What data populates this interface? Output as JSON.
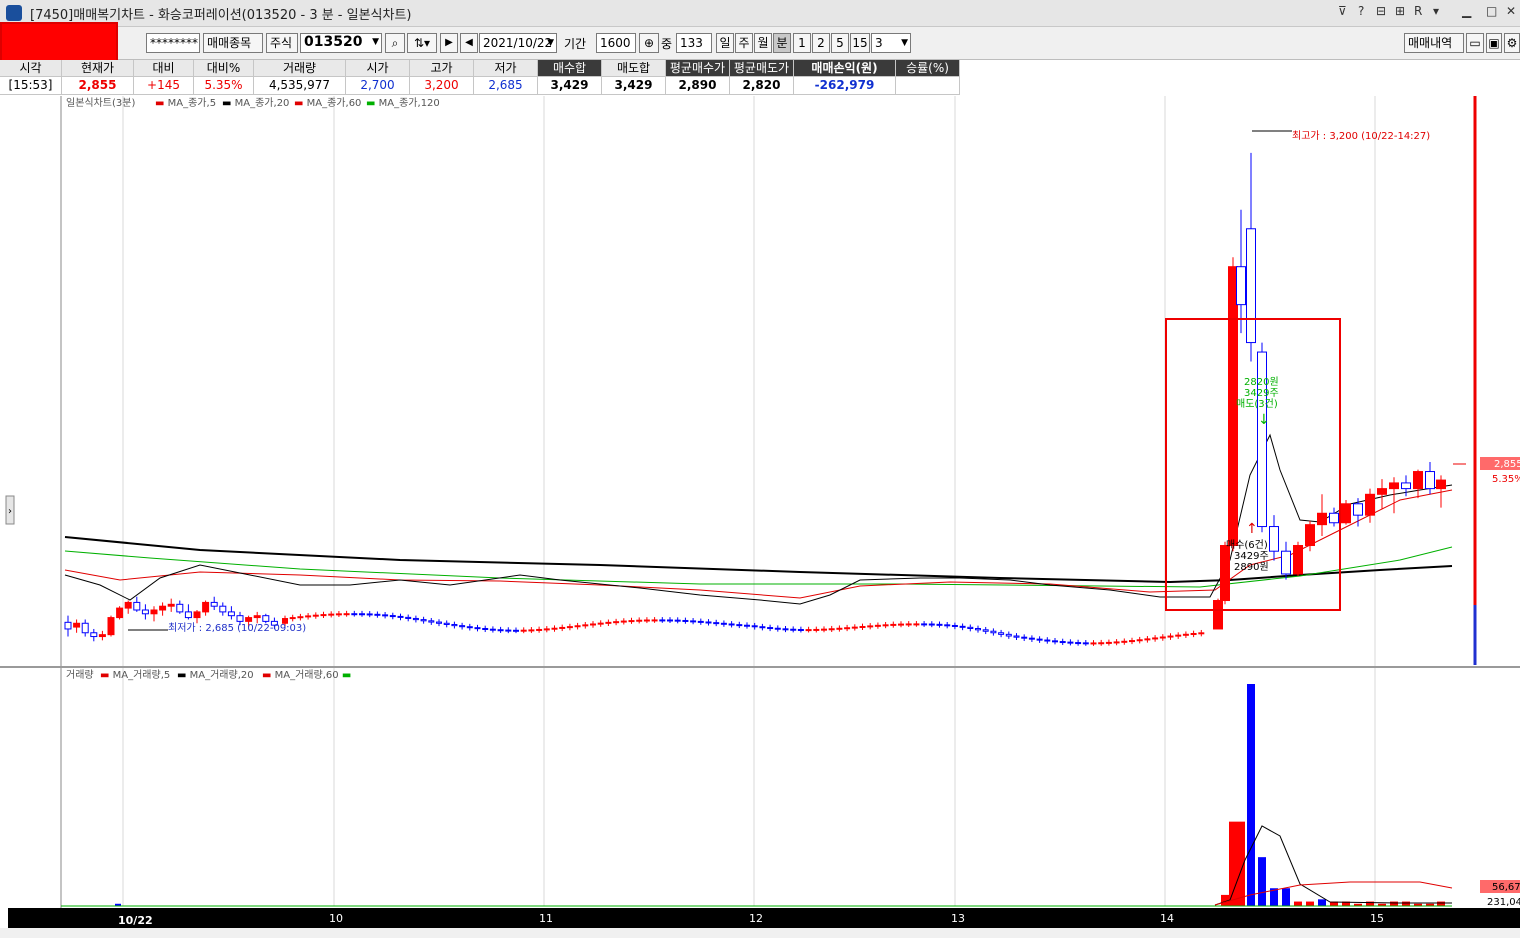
{
  "window": {
    "title": "[7450]매매복기차트 - 화승코퍼레이션(013520 - 3 분 - 일본식차트)",
    "controls": [
      "?",
      "R"
    ]
  },
  "toolbar": {
    "password": "********",
    "trade_item_btn": "매매종목",
    "market_type": "주식",
    "code": "013520",
    "date": "2021/10/22",
    "period_label": "기간",
    "period_value": "1600",
    "mid_label": "중",
    "mid_value": "133",
    "tf_day": "일",
    "tf_week": "주",
    "tf_month": "월",
    "tf_min": "분",
    "n1": "1",
    "n2": "2",
    "n5": "5",
    "n15": "15",
    "interval": "3",
    "history_btn": "매매내역"
  },
  "info": {
    "headers": [
      "시각",
      "현재가",
      "대비",
      "대비%",
      "거래량",
      "시가",
      "고가",
      "저가",
      "매수합",
      "매도합",
      "평균매수가",
      "평균매도가",
      "매매손익(원)",
      "승률(%)"
    ],
    "values": [
      "[15:53]",
      "2,855",
      "+145",
      "5.35%",
      "4,535,977",
      "2,700",
      "3,200",
      "2,685",
      "3,429",
      "3,429",
      "2,890",
      "2,820",
      "-262,979",
      ""
    ]
  },
  "chart_data": {
    "type": "candlestick",
    "price_legend": [
      "일본식차트(3분)",
      "MA_종가,5",
      "MA_종가,20",
      "MA_종가,60",
      "MA_종가,120"
    ],
    "volume_legend": [
      "거래량",
      "MA_거래량,5",
      "MA_거래량,20",
      "MA_거래량,60"
    ],
    "x_tick_labels": [
      "10/22",
      "10",
      "11",
      "12",
      "13",
      "14",
      "15"
    ],
    "ylim": [
      2660,
      3260
    ],
    "current_price_label": "2,855",
    "current_pct_label": "5.35%",
    "volume_label_1": "56,67",
    "volume_label_2": "231,04",
    "high_annotation": "최고가 : 3,200 (10/22-14:27)",
    "low_annotation": "최저가 : 2,685 (10/22-09:03)",
    "sell_marker": {
      "price": "2820원",
      "qty": "3429주",
      "label": "매도(3건)"
    },
    "buy_marker": {
      "label": "매수(6건)",
      "qty": "3429주",
      "price": "2890원"
    },
    "colors": {
      "up": "#ff0000",
      "down": "#0000ff",
      "ma5": "#e00000",
      "ma20": "#000000",
      "ma60": "#00b000",
      "ma120": "#000000"
    },
    "candles_morning": [
      [
        2705,
        2712,
        2690,
        2698
      ],
      [
        2700,
        2708,
        2694,
        2704
      ],
      [
        2704,
        2708,
        2690,
        2694
      ],
      [
        2694,
        2698,
        2685,
        2690
      ],
      [
        2690,
        2696,
        2686,
        2692
      ],
      [
        2692,
        2712,
        2690,
        2710
      ],
      [
        2710,
        2722,
        2708,
        2720
      ],
      [
        2720,
        2728,
        2714,
        2726
      ],
      [
        2726,
        2732,
        2716,
        2718
      ],
      [
        2718,
        2724,
        2708,
        2714
      ],
      [
        2714,
        2722,
        2706,
        2718
      ],
      [
        2718,
        2726,
        2712,
        2722
      ],
      [
        2722,
        2730,
        2716,
        2724
      ],
      [
        2724,
        2728,
        2714,
        2716
      ],
      [
        2716,
        2724,
        2708,
        2710
      ],
      [
        2710,
        2718,
        2704,
        2716
      ],
      [
        2716,
        2728,
        2712,
        2726
      ],
      [
        2726,
        2732,
        2718,
        2722
      ],
      [
        2722,
        2726,
        2712,
        2716
      ],
      [
        2716,
        2722,
        2708,
        2712
      ],
      [
        2712,
        2716,
        2702,
        2706
      ],
      [
        2706,
        2712,
        2700,
        2710
      ],
      [
        2710,
        2716,
        2704,
        2712
      ],
      [
        2712,
        2714,
        2704,
        2706
      ],
      [
        2706,
        2710,
        2698,
        2702
      ]
    ],
    "volume_scale_max": 100
  }
}
